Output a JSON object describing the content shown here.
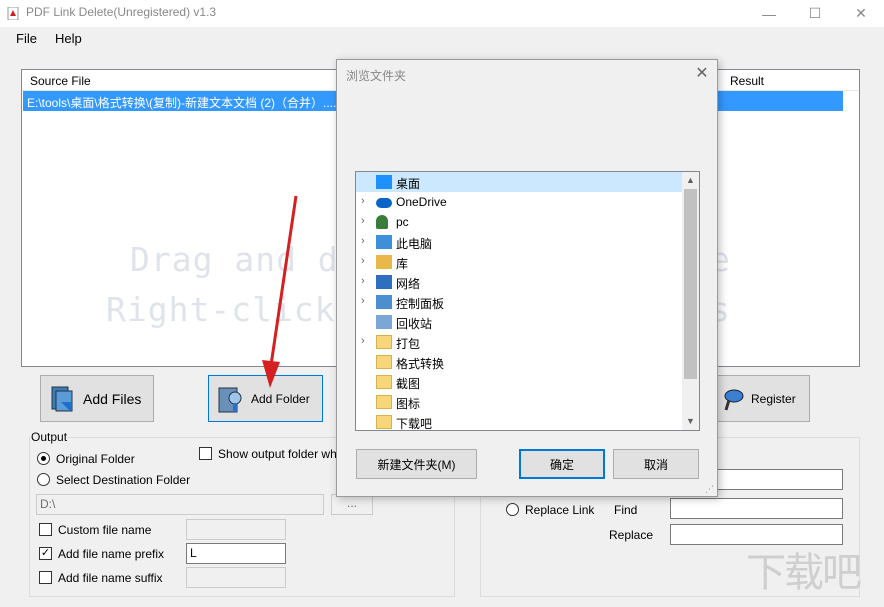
{
  "window": {
    "title": "PDF Link Delete(Unregistered) v1.3",
    "min_glyph": "—",
    "max_glyph": "☐",
    "close_glyph": "✕"
  },
  "menu": {
    "file": "File",
    "help": "Help"
  },
  "file_list": {
    "columns": {
      "source": "Source File",
      "result": "Result"
    },
    "rows": [
      {
        "source": "E:\\tools\\桌面\\格式转换\\(复制)-新建文本文档 (2)（合并）...."
      }
    ],
    "hint_line1": "Drag and dro",
    "hint_line2": "Right-click",
    "hint_line1_tail": "e",
    "hint_line2_tail": "s"
  },
  "buttons": {
    "add_files": "Add Files",
    "add_folder": "Add Folder",
    "register": "Register"
  },
  "output": {
    "legend": "Output",
    "original_folder": "Original Folder",
    "select_destination": "Select Destination Folder",
    "show_output": "Show output folder wh",
    "destination_path": "D:\\",
    "browse": "...",
    "custom_name": "Custom file name",
    "add_prefix": "Add file name prefix",
    "prefix_value": "L",
    "add_suffix": "Add file name suffix"
  },
  "right_panel": {
    "replace_link": "Replace Link",
    "find": "Find",
    "replace": "Replace"
  },
  "dialog": {
    "title": "浏览文件夹",
    "close_glyph": "✕",
    "tree": [
      {
        "label": "桌面",
        "icon": "desktop-icon",
        "color": "#1e90ff"
      },
      {
        "label": "OneDrive",
        "icon": "cloud-icon",
        "color": "#0a64c8"
      },
      {
        "label": "pc",
        "icon": "user-icon",
        "color": "#3a7d3a"
      },
      {
        "label": "此电脑",
        "icon": "computer-icon",
        "color": "#3c8fd8"
      },
      {
        "label": "库",
        "icon": "library-icon",
        "color": "#e8b84a"
      },
      {
        "label": "网络",
        "icon": "network-icon",
        "color": "#2f6fbf"
      },
      {
        "label": "控制面板",
        "icon": "control-panel-icon",
        "color": "#4a8fd0"
      },
      {
        "label": "回收站",
        "icon": "recycle-bin-icon",
        "color": "#7aa7d6"
      },
      {
        "label": "打包",
        "icon": "folder-icon",
        "color": "#f7d57a"
      },
      {
        "label": "格式转换",
        "icon": "folder-icon",
        "color": "#f7d57a"
      },
      {
        "label": "截图",
        "icon": "folder-icon",
        "color": "#f7d57a"
      },
      {
        "label": "图标",
        "icon": "folder-icon",
        "color": "#f7d57a"
      },
      {
        "label": "下载吧",
        "icon": "folder-icon",
        "color": "#f7d57a"
      }
    ],
    "expand_glyph": "›",
    "scroll_up": "▲",
    "scroll_down": "▼",
    "new_folder": "新建文件夹(M)",
    "ok": "确定",
    "cancel": "取消"
  },
  "watermark": "下载吧",
  "colors": {
    "selection": "#3399ff",
    "accent": "#0078d7",
    "arrow": "#d42020"
  }
}
